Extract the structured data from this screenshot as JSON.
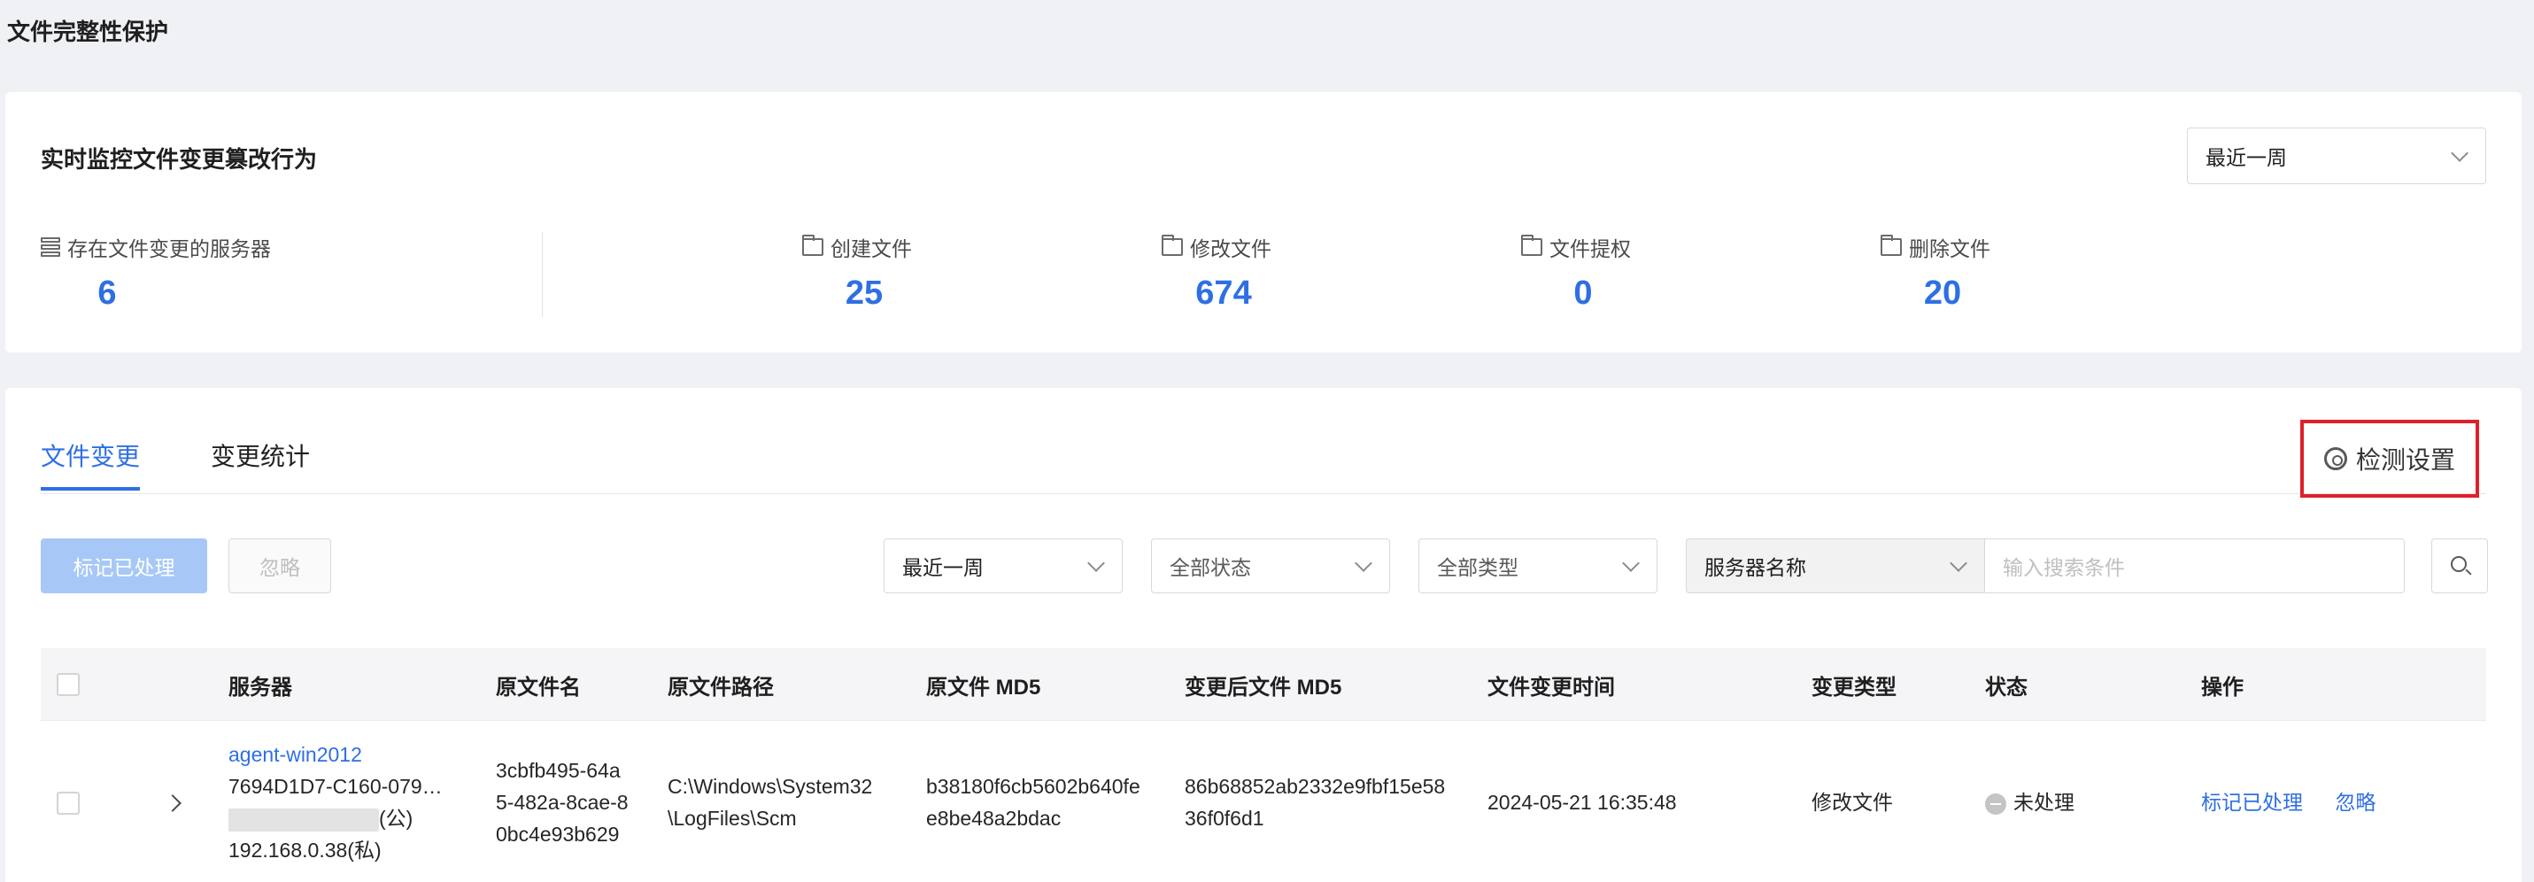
{
  "page": {
    "title": "文件完整性保护"
  },
  "summary": {
    "title": "实时监控文件变更篡改行为",
    "period_select": "最近一周",
    "stats": [
      {
        "label": "存在文件变更的服务器",
        "value": "6",
        "icon": "server-icon"
      },
      {
        "label": "创建文件",
        "value": "25",
        "icon": "folder-icon"
      },
      {
        "label": "修改文件",
        "value": "674",
        "icon": "folder-icon"
      },
      {
        "label": "文件提权",
        "value": "0",
        "icon": "folder-icon"
      },
      {
        "label": "删除文件",
        "value": "20",
        "icon": "folder-icon"
      }
    ],
    "value_color": "#2f6fe4"
  },
  "tabs": [
    {
      "label": "文件变更",
      "active": true
    },
    {
      "label": "变更统计",
      "active": false
    }
  ],
  "settings": {
    "label": "检测设置",
    "highlight_color": "#e0202a"
  },
  "toolbar": {
    "mark_handled": "标记已处理",
    "ignore": "忽略",
    "period": "最近一周",
    "status": "全部状态",
    "type": "全部类型",
    "search_field": "服务器名称",
    "search_placeholder": "输入搜索条件"
  },
  "table": {
    "columns": [
      "服务器",
      "原文件名",
      "原文件路径",
      "原文件 MD5",
      "变更后文件 MD5",
      "文件变更时间",
      "变更类型",
      "状态",
      "操作"
    ],
    "rows": [
      {
        "server_name": "agent-win2012",
        "server_id": "7694D1D7-C160-079…",
        "public_ip_suffix": "(公)",
        "private_ip": "192.168.0.38(私)",
        "file_name_lines": [
          "3cbfb495-64a",
          "5-482a-8cae-8",
          "0bc4e93b629"
        ],
        "path_lines": [
          "C:\\Windows\\System32",
          "\\LogFiles\\Scm"
        ],
        "md5_lines": [
          "b38180f6cb5602b640fe",
          "e8be48a2bdac"
        ],
        "md5_after_lines": [
          "86b68852ab2332e9fbf15e58",
          "36f0f6d1"
        ],
        "time": "2024-05-21 16:35:48",
        "change_type": "修改文件",
        "status": "未处理",
        "actions": [
          "标记已处理",
          "忽略"
        ]
      }
    ]
  }
}
